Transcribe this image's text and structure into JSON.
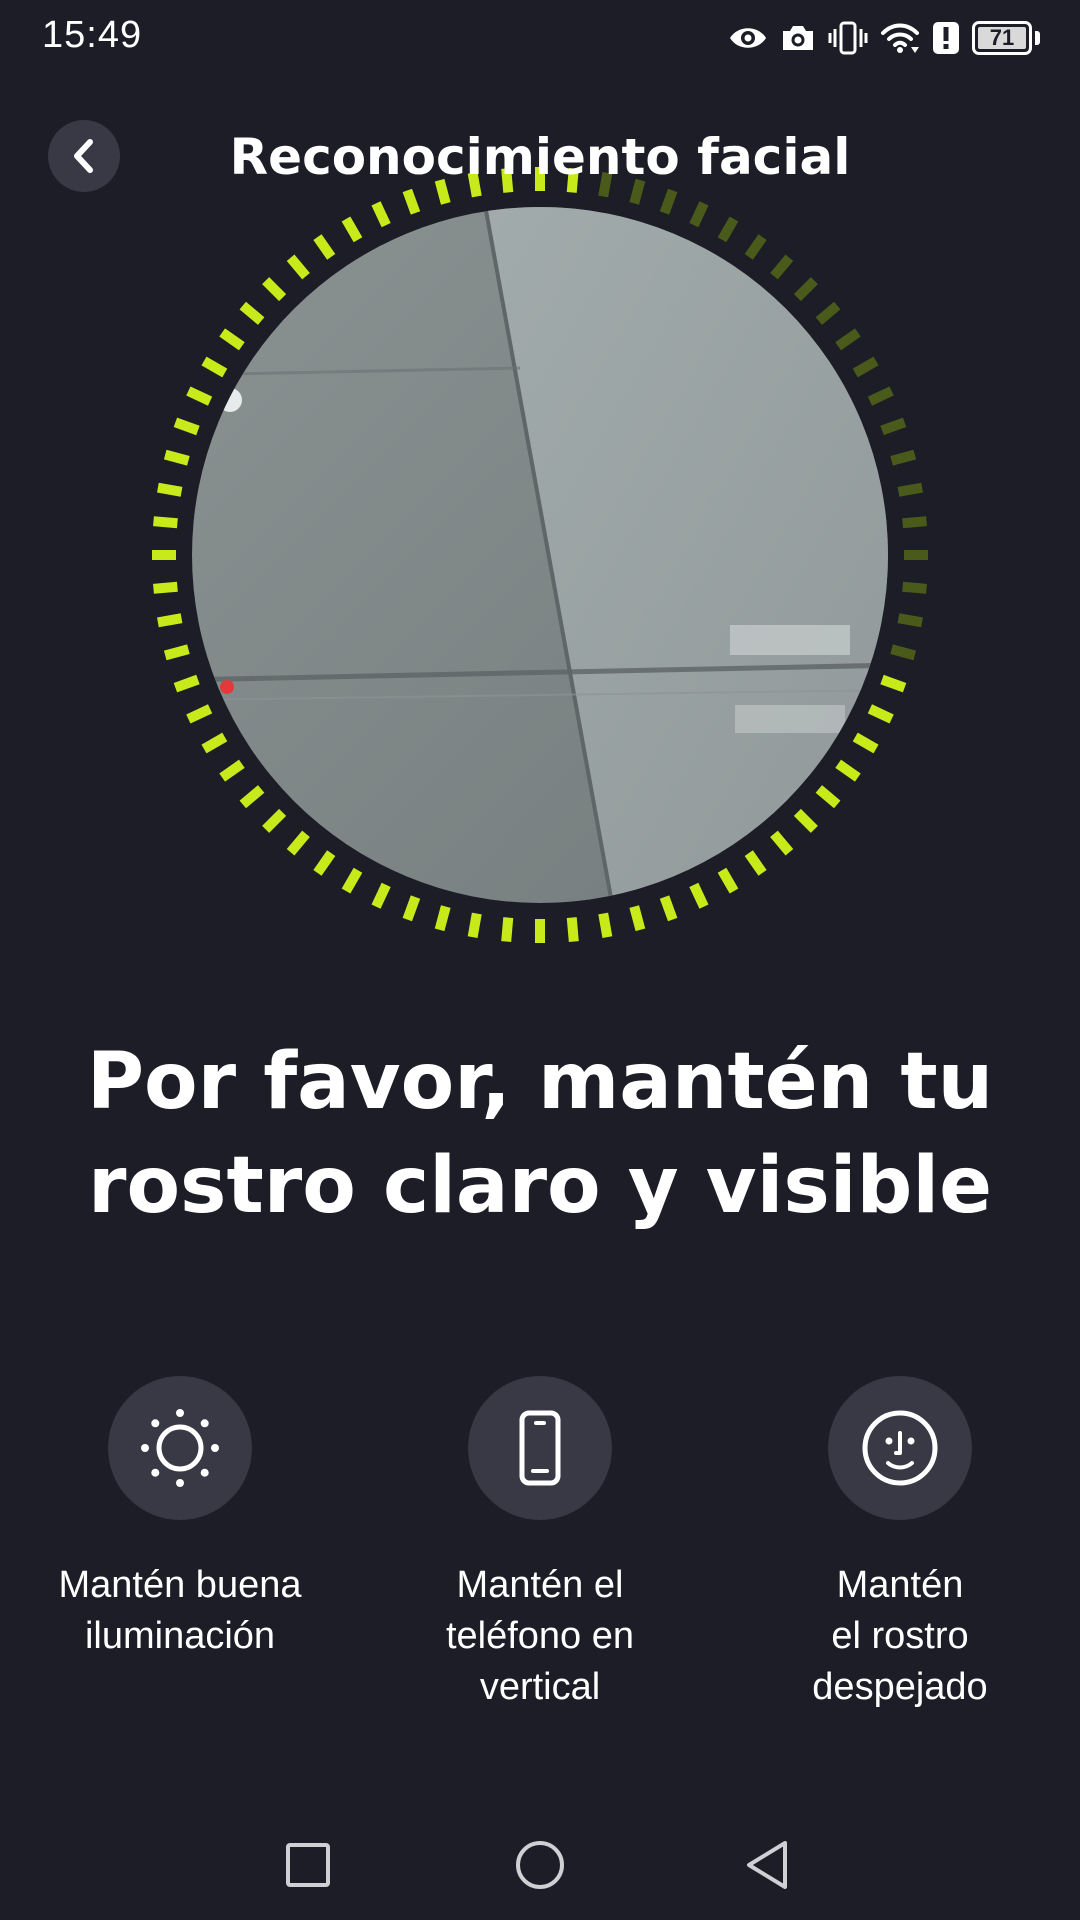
{
  "status_bar": {
    "time": "15:49",
    "battery_level": "71",
    "icons": [
      "eye-icon",
      "camera-icon",
      "vibrate-icon",
      "wifi-icon",
      "alert-icon",
      "battery-icon"
    ]
  },
  "header": {
    "title": "Reconocimiento facial",
    "back_icon": "chevron-left-icon"
  },
  "camera": {
    "progress_color": "#c8ea1a",
    "track_color": "#4a5a1a",
    "progress_fraction": 0.72
  },
  "instruction": {
    "line1": "Por favor, mantén tu",
    "line2": "rostro claro y visible"
  },
  "tips": [
    {
      "icon": "sun-icon",
      "line1": "Mantén buena",
      "line2": "iluminación",
      "line3": ""
    },
    {
      "icon": "phone-icon",
      "line1": "Mantén el",
      "line2": "teléfono en",
      "line3": "vertical"
    },
    {
      "icon": "face-icon",
      "line1": "Mantén",
      "line2": "el rostro",
      "line3": "despejado"
    }
  ],
  "nav_bar": {
    "icons": [
      "recents-icon",
      "home-icon",
      "back-triangle-icon"
    ]
  }
}
